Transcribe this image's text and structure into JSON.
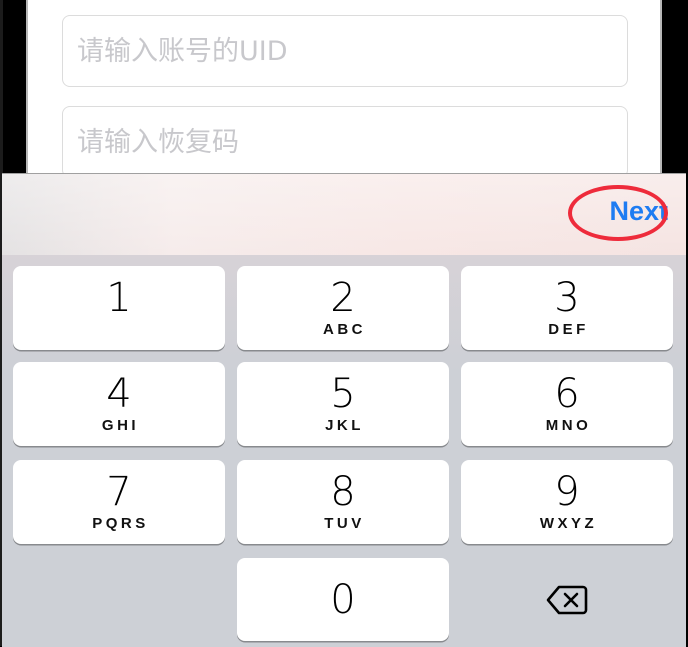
{
  "form": {
    "uid_placeholder": "请输入账号的UID",
    "uid_value": "",
    "recovery_code_placeholder": "请输入恢复码",
    "recovery_code_value": ""
  },
  "keyboard": {
    "accessory": {
      "next_label": "Next",
      "next_color": "#1e7cf2",
      "highlight_color": "#ee2b3b"
    },
    "keys": [
      {
        "digit": "1",
        "letters": ""
      },
      {
        "digit": "2",
        "letters": "ABC"
      },
      {
        "digit": "3",
        "letters": "DEF"
      },
      {
        "digit": "4",
        "letters": "GHI"
      },
      {
        "digit": "5",
        "letters": "JKL"
      },
      {
        "digit": "6",
        "letters": "MNO"
      },
      {
        "digit": "7",
        "letters": "PQRS"
      },
      {
        "digit": "8",
        "letters": "TUV"
      },
      {
        "digit": "9",
        "letters": "WXYZ"
      },
      {
        "digit": "0",
        "letters": ""
      }
    ],
    "delete_icon": "backspace-icon"
  }
}
